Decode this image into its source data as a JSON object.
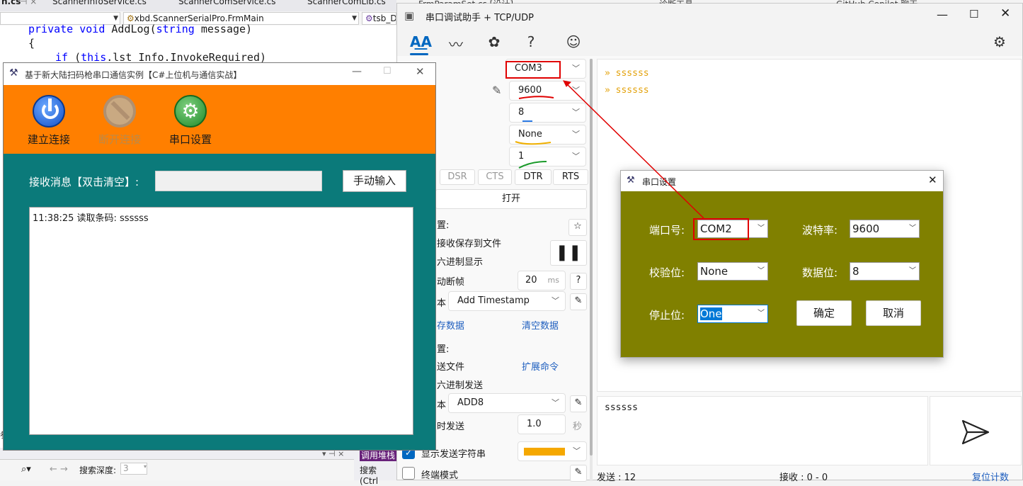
{
  "vs": {
    "tabs": [
      "n.cs",
      "ScannerInfoService.cs",
      "ScannerComService.cs",
      "ScannerComLib.cs"
    ],
    "combo1": "",
    "combo2": "xbd.ScannerSerialPro.FrmMain",
    "combo3": "tsb_D",
    "code": {
      "line1_kw": "private void",
      "line1_rest": " AddLog(",
      "line1_kw2": "string",
      "line1_end": " message)",
      "line2": "{",
      "line3_kw": "if",
      "line3_open": " (",
      "line3_kw2": "this",
      "line3_rest": ".lst_Info.InvokeRequired)"
    },
    "bottom": {
      "search_depth_label": "搜索深度:",
      "search_depth_value": "3",
      "call_stack": "调用堆栈",
      "search_ctrl": "搜索(Ctrl"
    }
  },
  "helper": {
    "title": "串口调试助手 + TCP/UDP",
    "partial_tab": "FrmParamSet.cs [设计]",
    "port": "COM3",
    "baud": "9600",
    "databits": "8",
    "parity": "None",
    "stopbits": "1",
    "signals": [
      "DSR",
      "CTS",
      "DTR",
      "RTS"
    ],
    "open_button": "打开",
    "recv_section": "置:",
    "save_to_file": "接收保存到文件",
    "hex_display": "六进制显示",
    "auto_frame": "动断帧",
    "frame_ms": "20",
    "ms_unit": "ms",
    "timestamp": "Add Timestamp",
    "save_data": "存数据",
    "clear_data": "清空数据",
    "send_section": "置:",
    "send_file": "送文件",
    "ext_cmd": "扩展命令",
    "hex_send": "六进制发送",
    "checksum": "ADD8",
    "timed_send": "时发送",
    "interval": "1.0",
    "sec_unit": "秒",
    "show_send_chars": "显示发送字符串",
    "terminal_mode": "终端模式",
    "rx_lines": [
      "» ssssss",
      "» ssssss"
    ],
    "tx_text": "ssssss",
    "status_sent": "发送 : 12",
    "status_recv": "接收 : 0 - 0",
    "reset_count": "复位计数",
    "copilot_tab": "GitHub Copilot 聊天",
    "other_tab": "诊断工具"
  },
  "scanner": {
    "title": "基于新大陆扫码枪串口通信实例【C#上位机与通信实战】",
    "btn_connect": "建立连接",
    "btn_disconnect": "断开连接",
    "btn_settings": "串口设置",
    "recv_label": "接收消息【双击清空】:",
    "manual_input": "手动输入",
    "log": [
      "11:38:25 读取条码: ssssss"
    ]
  },
  "dialog": {
    "title": "串口设置",
    "port_label": "端口号:",
    "port_value": "COM2",
    "baud_label": "波特率:",
    "baud_value": "9600",
    "parity_label": "校验位:",
    "parity_value": "None",
    "databits_label": "数据位:",
    "databits_value": "8",
    "stopbits_label": "停止位:",
    "stopbits_value": "One",
    "ok": "确定",
    "cancel": "取消"
  },
  "colors": {
    "accent_blue": "#0067c0",
    "scanner_teal": "#0b7a7a",
    "scanner_orange": "#ff7f00",
    "dialog_olive": "#808000",
    "rx_text": "#e3a20b",
    "annotation_red": "#e00000"
  }
}
